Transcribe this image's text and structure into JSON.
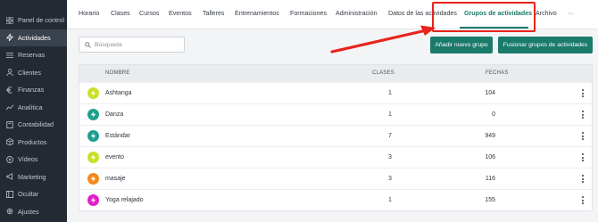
{
  "sidebar": {
    "items": [
      {
        "label": "Panel de control",
        "icon": "grid-icon"
      },
      {
        "label": "Actividades",
        "icon": "lightning-icon",
        "active": true
      },
      {
        "label": "Reservas",
        "icon": "list-icon"
      },
      {
        "label": "Clientes",
        "icon": "user-icon"
      },
      {
        "label": "Finanzas",
        "icon": "euro-icon"
      },
      {
        "label": "Analítica",
        "icon": "chart-icon"
      },
      {
        "label": "Contabilidad",
        "icon": "calculator-icon"
      },
      {
        "label": "Productos",
        "icon": "box-icon"
      },
      {
        "label": "Vídeos",
        "icon": "play-icon"
      },
      {
        "label": "Marketing",
        "icon": "megaphone-icon"
      },
      {
        "label": "Ocultar",
        "icon": "hide-icon"
      },
      {
        "label": "Ajustes",
        "icon": "gear-icon"
      }
    ]
  },
  "topnav": {
    "tabs": [
      {
        "label": "Horario"
      },
      {
        "label": "Clases"
      },
      {
        "label": "Cursos"
      },
      {
        "label": "Eventos"
      },
      {
        "label": "Talleres"
      },
      {
        "label": "Entrenamientos"
      },
      {
        "label": "Formaciones"
      },
      {
        "label": "Administración"
      },
      {
        "label": "Datos de las actividades"
      },
      {
        "label": "Grupos de actividades",
        "active": true
      },
      {
        "label": "Archivo"
      },
      {
        "label": "···"
      }
    ]
  },
  "toolbar": {
    "search_placeholder": "Búsqueda",
    "add_group_label": "Añadir nuevo grupo",
    "merge_groups_label": "Fusionar grupos de actividades"
  },
  "table": {
    "headers": {
      "name": "NOMBRE",
      "classes": "CLASES",
      "dates": "FECHAS"
    },
    "rows": [
      {
        "name": "Ashtanga",
        "classes": "1",
        "dates": "104",
        "color": "#c8e02a"
      },
      {
        "name": "Danza",
        "classes": "1",
        "dates": "0",
        "color": "#1f9e8c"
      },
      {
        "name": "Estándar",
        "classes": "7",
        "dates": "949",
        "color": "#1f9e8c"
      },
      {
        "name": "evento",
        "classes": "3",
        "dates": "106",
        "color": "#c8e02a"
      },
      {
        "name": "masaje",
        "classes": "3",
        "dates": "116",
        "color": "#f08a1f"
      },
      {
        "name": "Yoga relajado",
        "classes": "1",
        "dates": "155",
        "color": "#e020c8"
      }
    ]
  },
  "colors": {
    "accent": "#1b7b6b",
    "sidebar_bg": "#232a34",
    "annotation": "#e8231c"
  }
}
